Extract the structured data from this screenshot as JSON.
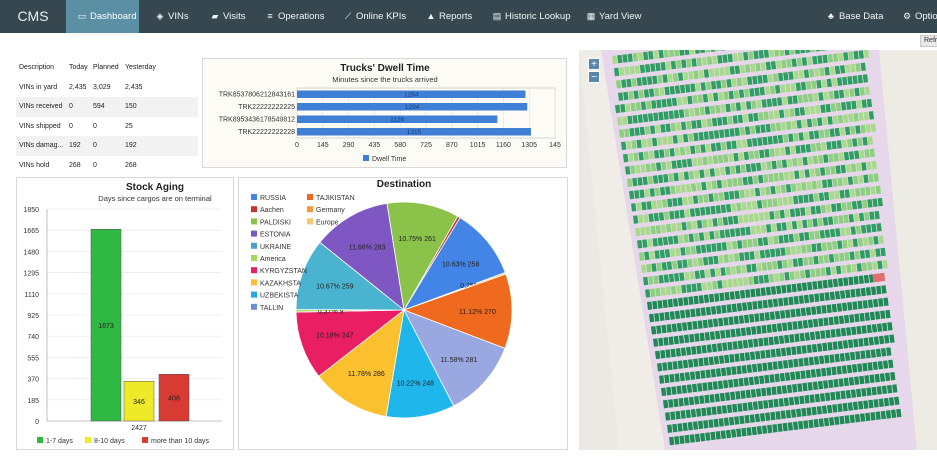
{
  "nav": {
    "brand": "CMS",
    "items": [
      {
        "label": "Dashboard",
        "icon": "monitor-icon",
        "glyph": "▭"
      },
      {
        "label": "VINs",
        "icon": "car-icon",
        "glyph": "🚗"
      },
      {
        "label": "Visits",
        "icon": "truck-icon",
        "glyph": "▰"
      },
      {
        "label": "Operations",
        "icon": "tasks-icon",
        "glyph": "≡"
      },
      {
        "label": "Online KPIs",
        "icon": "line-chart-icon",
        "glyph": "⟋"
      },
      {
        "label": "Reports",
        "icon": "area-chart-icon",
        "glyph": "▲"
      },
      {
        "label": "Historic Lookup",
        "icon": "database-icon",
        "glyph": "▤"
      },
      {
        "label": "Yard View",
        "icon": "grid-icon",
        "glyph": "▦"
      },
      {
        "label": "Base Data",
        "icon": "users-icon",
        "glyph": "👥"
      },
      {
        "label": "Options",
        "icon": "gear-icon",
        "glyph": "⚙"
      }
    ],
    "refresh_label": "Refr"
  },
  "summary": {
    "headers": [
      "Description",
      "Today",
      "Planned",
      "Yesterday"
    ],
    "rows": [
      [
        "VINs in yard",
        "2,435",
        "3,029",
        "2,435"
      ],
      [
        "VINs received",
        "0",
        "594",
        "150"
      ],
      [
        "VINs shipped",
        "0",
        "0",
        "25"
      ],
      [
        "VINs damag...",
        "192",
        "0",
        "192"
      ],
      [
        "VINs hold",
        "268",
        "0",
        "268"
      ]
    ]
  },
  "map": {
    "zoom_in": "+",
    "zoom_out": "−"
  },
  "chart_data": [
    {
      "type": "bar",
      "orientation": "horizontal",
      "title": "Trucks' Dwell Time",
      "subtitle": "Minutes since the trucks arrived",
      "categories": [
        "TRK853780621284316​1",
        "TRK22222222225",
        "TRK895343617854981​2",
        "TRK22222222228"
      ],
      "series": [
        {
          "name": "Dwell Time",
          "values": [
            1284,
            1294,
            1126,
            1315
          ],
          "color": "#3f7fd6"
        }
      ],
      "x_ticks": [
        "0",
        "145",
        "290",
        "435",
        "580",
        "725",
        "870",
        "1015",
        "1160",
        "1305",
        "145"
      ],
      "xlim": [
        0,
        1450
      ],
      "legend": "bottom"
    },
    {
      "type": "bar",
      "title": "Stock Aging",
      "subtitle": "Days since cargos are on terminal",
      "categories": [
        "1-7 days",
        "8-10 days",
        "more than 10 days"
      ],
      "values": [
        1673,
        346,
        408
      ],
      "colors": [
        "#2fb843",
        "#eeea2a",
        "#d83a34"
      ],
      "y_ticks": [
        "0",
        "185",
        "370",
        "555",
        "740",
        "925",
        "1110",
        "1295",
        "1480",
        "1665",
        "1850"
      ],
      "ylim": [
        0,
        1850
      ],
      "x_label": "2427",
      "legend": "bottom"
    },
    {
      "type": "pie",
      "title": "Destination",
      "legend_labels": [
        "RUSSIA",
        "TAJIKISTAN",
        "Aachen",
        "Germany",
        "PALDISKI",
        "Europe",
        "ESTONIA",
        "UKRAINE",
        "America",
        "KYRGYZSTAN",
        "KAZAKHSTA",
        "UZBEKISTA",
        "TALLIN"
      ],
      "legend_colors": [
        "#4285e6",
        "#ef6a1e",
        "#c7362e",
        "#f49a3c",
        "#8bc34a",
        "#f9c86b",
        "#7e57c2",
        "#4aa3c6",
        "#a8d65a",
        "#e91e63",
        "#fbc02d",
        "#26a9e0",
        "#6e8fcf"
      ],
      "slices": [
        {
          "label": "0.41% 10",
          "value": 10,
          "color": "#c7362e"
        },
        {
          "label": "10.63% 258",
          "value": 258,
          "color": "#4285e6"
        },
        {
          "label": "0.25% 6",
          "value": 6,
          "color": "#f9c86b"
        },
        {
          "label": "11.12% 270",
          "value": 270,
          "color": "#ef6a1e"
        },
        {
          "label": "11.58% 281",
          "value": 281,
          "color": "#9aa8e2"
        },
        {
          "label": "10.22% 248",
          "value": 248,
          "color": "#1fb6ec"
        },
        {
          "label": "11.78% 286",
          "value": 286,
          "color": "#fbc02d"
        },
        {
          "label": "10.18% 247",
          "value": 247,
          "color": "#e91e63"
        },
        {
          "label": "0.37% 9",
          "value": 9,
          "color": "#a8d65a"
        },
        {
          "label": "10.67% 259",
          "value": 259,
          "color": "#4ab3cf"
        },
        {
          "label": "11.66% 283",
          "value": 283,
          "color": "#7e57c2"
        },
        {
          "label": "10.75% 261",
          "value": 261,
          "color": "#8bc34a"
        }
      ]
    }
  ]
}
